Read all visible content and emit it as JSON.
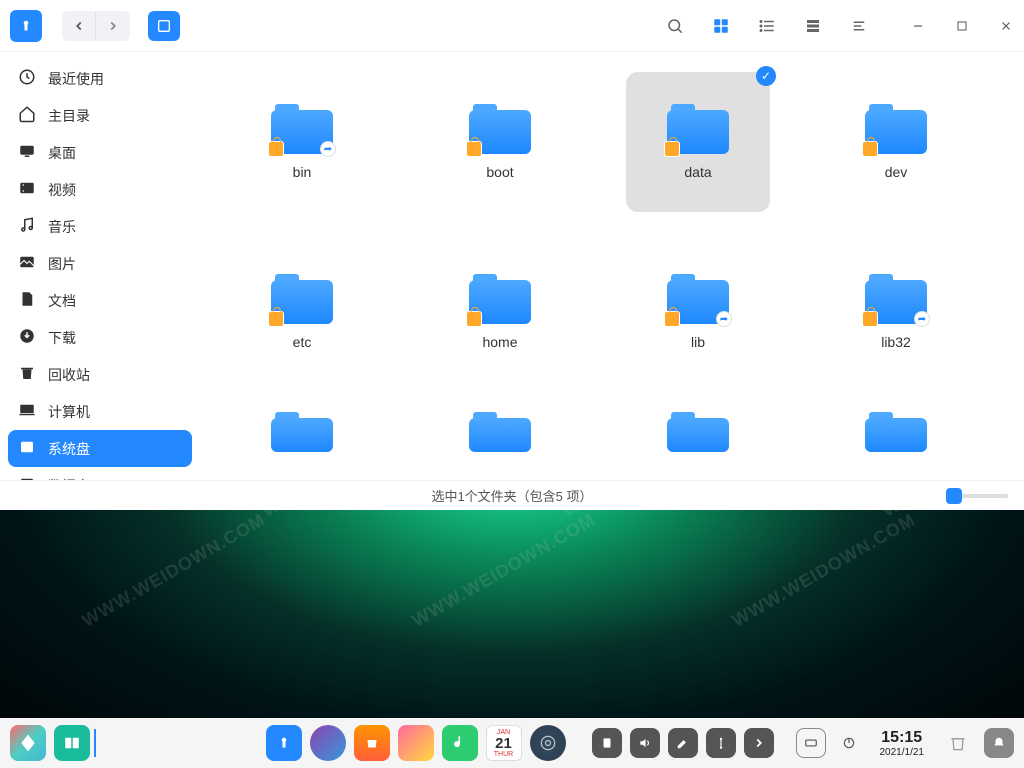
{
  "sidebar": {
    "items": [
      {
        "label": "最近使用",
        "icon": "clock"
      },
      {
        "label": "主目录",
        "icon": "home"
      },
      {
        "label": "桌面",
        "icon": "desktop"
      },
      {
        "label": "视频",
        "icon": "video"
      },
      {
        "label": "音乐",
        "icon": "music"
      },
      {
        "label": "图片",
        "icon": "image"
      },
      {
        "label": "文档",
        "icon": "document"
      },
      {
        "label": "下载",
        "icon": "download"
      },
      {
        "label": "回收站",
        "icon": "trash"
      },
      {
        "label": "计算机",
        "icon": "computer"
      },
      {
        "label": "系统盘",
        "icon": "disk",
        "active": true
      },
      {
        "label": "数据盘",
        "icon": "disk"
      }
    ]
  },
  "folders": [
    {
      "name": "bin",
      "lock": true,
      "share": true
    },
    {
      "name": "boot",
      "lock": true
    },
    {
      "name": "data",
      "lock": true,
      "selected": true
    },
    {
      "name": "dev",
      "lock": true
    },
    {
      "name": "etc",
      "lock": true
    },
    {
      "name": "home",
      "lock": true
    },
    {
      "name": "lib",
      "lock": true,
      "share": true
    },
    {
      "name": "lib32",
      "lock": true,
      "share": true
    },
    {
      "name": "",
      "partial": true
    },
    {
      "name": "",
      "partial": true
    },
    {
      "name": "",
      "partial": true
    },
    {
      "name": "",
      "partial": true
    }
  ],
  "statusbar": {
    "text": "选中1个文件夹（包含5 项）"
  },
  "taskbar": {
    "calendar": {
      "month": "JAN",
      "day": "21",
      "dow": "THUR"
    },
    "clock": {
      "time": "15:15",
      "date": "2021/1/21"
    }
  },
  "watermark": "WWW.WEIDOWN.COM"
}
